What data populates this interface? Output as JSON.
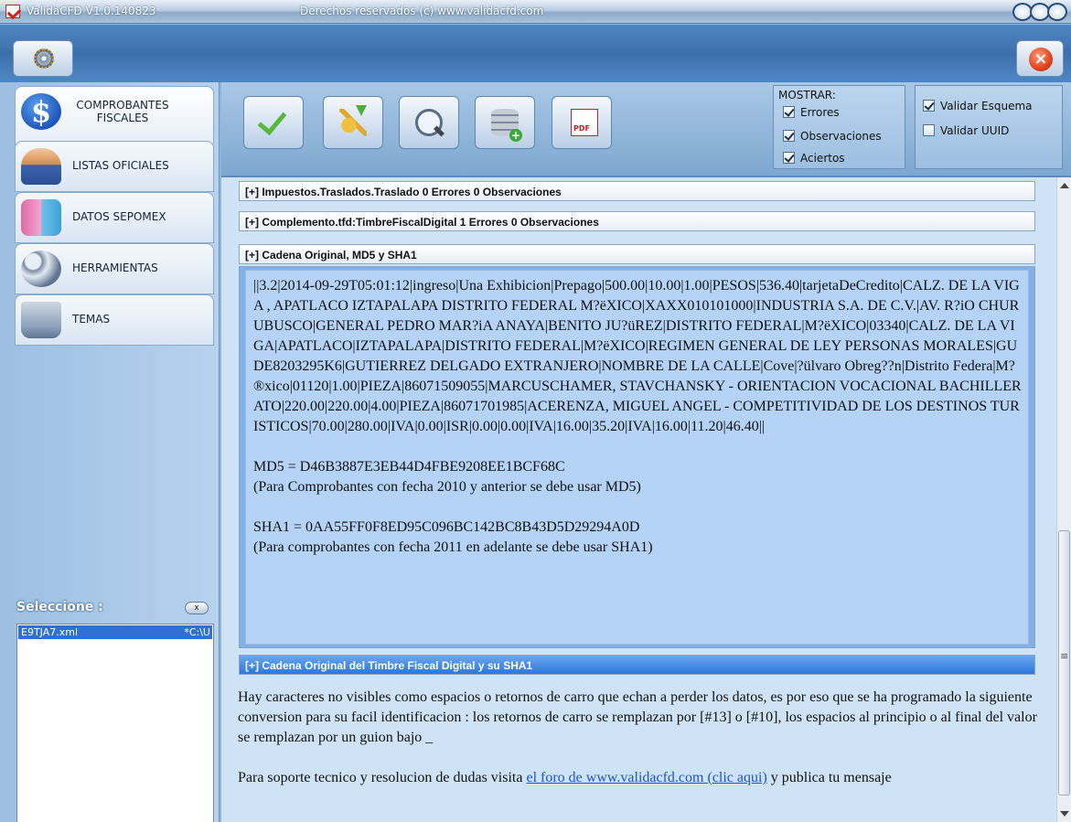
{
  "window": {
    "title": "ValidaCFD V1.0.140823",
    "subtitle": "Derechos reservados (c) www.validacfd.com"
  },
  "sidebar": {
    "items": [
      {
        "label": "COMPROBANTES FISCALES",
        "icon": "dollar-icon"
      },
      {
        "label": "LISTAS OFICIALES",
        "icon": "person-icon"
      },
      {
        "label": "DATOS SEPOMEX",
        "icon": "mail-icon"
      },
      {
        "label": "HERRAMIENTAS",
        "icon": "tools-icon"
      },
      {
        "label": "TEMAS",
        "icon": "monitor-icon"
      }
    ],
    "seleccione_label": "Seleccione :",
    "clear_label": "x",
    "files": [
      {
        "name": "E9TJA7.xml",
        "path": "*C:\\U"
      }
    ]
  },
  "toolbar": {
    "buttons": [
      "validate-button",
      "key-button",
      "search-button",
      "database-add-button",
      "pdf-button"
    ],
    "pdf_label": "PDF"
  },
  "mostrar": {
    "title": "MOSTRAR:",
    "options": [
      {
        "label": "Errores",
        "checked": true
      },
      {
        "label": "Observaciones",
        "checked": true
      },
      {
        "label": "Aciertos",
        "checked": true
      }
    ]
  },
  "validar": {
    "options": [
      {
        "label": "Validar Esquema",
        "checked": true
      },
      {
        "label": "Validar UUID",
        "checked": false
      }
    ]
  },
  "sections": [
    {
      "label": "[+] Impuestos.Traslados.Traslado   0 Errores   0 Observaciones"
    },
    {
      "label": "[+] Complemento.tfd:TimbreFiscalDigital   1 Errores   0 Observaciones"
    },
    {
      "label": "[+] Cadena Original, MD5 y SHA1"
    },
    {
      "label": "[+] Cadena Original del Timbre Fiscal Digital y su SHA1"
    }
  ],
  "cadena": {
    "text": "||3.2|2014-09-29T05:01:12|ingreso|Una Exhibicion|Prepago|500.00|10.00|1.00|PESOS|536.40|tarjetaDeCredito|CALZ. DE LA VIGA , APATLACO IZTAPALAPA DISTRITO FEDERAL M?ëXICO|XAXX010101000|INDUSTRIA S.A. DE C.V.|AV. R?iO CHURUBUSCO|GENERAL PEDRO MAR?iA ANAYA|BENITO JU?üREZ|DISTRITO FEDERAL|M?ëXICO|03340|CALZ. DE LA VIGA|APATLACO|IZTAPALAPA|DISTRITO FEDERAL|M?ëXICO|REGIMEN GENERAL DE LEY PERSONAS MORALES|GUDE8203295K6|GUTIERREZ DELGADO EXTRANJERO|NOMBRE DE LA CALLE|Cove|?ülvaro Obreg??n|Distrito Federa|M?®xico|01120|1.00|PIEZA|86071509055|MARCUSCHAMER, STAVCHANSKY - ORIENTACION VOCACIONAL BACHILLERATO|220.00|220.00|4.00|PIEZA|86071701985|ACERENZA, MIGUEL ANGEL - COMPETITIVIDAD DE LOS DESTINOS TURISTICOS|70.00|280.00|IVA|0.00|ISR|0.00|0.00|IVA|16.00|35.20|IVA|16.00|11.20|46.40||",
    "md5": "MD5 = D46B3887E3EB44D4FBE9208EE1BCF68C",
    "md5_note": "(Para Comprobantes con fecha 2010 y anterior se debe usar MD5)",
    "sha1": "SHA1 = 0AA55FF0F8ED95C096BC142BC8B43D5D29294A0D",
    "sha1_note": "(Para comprobantes con fecha 2011 en adelante se debe usar SHA1)"
  },
  "footer": {
    "note": "Hay caracteres no visibles como espacios o retornos de carro que echan a perder los datos, es por eso que se ha programado la siguiente conversion para su facil identificacion : los retornos de carro se remplazan por [#13] o [#10], los espacios al principio o al final del valor se remplazan por un guion bajo _",
    "support_prefix": "Para soporte tecnico y resolucion de dudas visita ",
    "support_link": "el foro de www.validacfd.com (clic aqui)",
    "support_suffix": " y publica tu mensaje"
  }
}
